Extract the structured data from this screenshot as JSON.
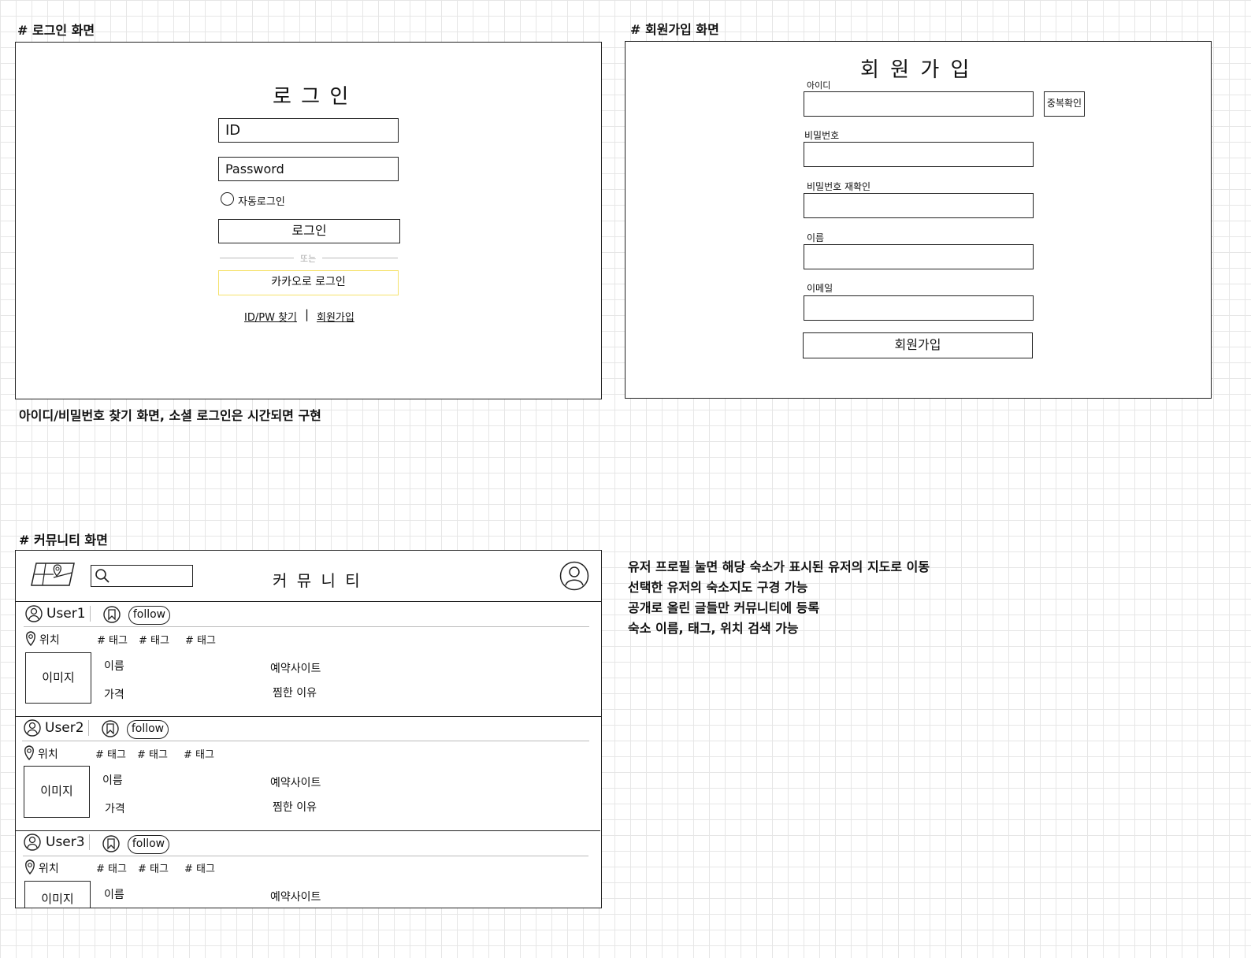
{
  "login": {
    "heading": "# 로그인 화면",
    "title": "로 그 인",
    "id_placeholder": "ID",
    "password_placeholder": "Password",
    "auto_login": "자동로그인",
    "login_button": "로그인",
    "divider": "또는",
    "kakao_button": "카카오로 로그인",
    "find_link": "ID/PW 찾기",
    "link_separator": "|",
    "signup_link": "회원가입",
    "kakao_color": "#f5e26b"
  },
  "signup": {
    "heading": "# 회원가입 화면",
    "title": "회 원 가 입",
    "id_label": "아이디",
    "dup_check": "중복확인",
    "pw_label": "비밀번호",
    "pw_confirm_label": "비밀번호  재확인",
    "name_label": "이름",
    "email_label": "이메일",
    "submit": "회원가입"
  },
  "memo_login": "아이디/비밀번호 찾기 화면, 소셜 로그인은 시간되면 구현",
  "community": {
    "heading": "# 커뮤니티 화면",
    "title": "커 뮤 니 티",
    "posts": [
      {
        "user": "User1",
        "follow": "follow",
        "location": "위치",
        "tags": [
          "# 태그",
          "# 태그",
          "# 태그"
        ],
        "image": "이미지",
        "name": "이름",
        "price": "가격",
        "site": "예약사이트",
        "reason": "찜한 이유"
      },
      {
        "user": "User2",
        "follow": "follow",
        "location": "위치",
        "tags": [
          "# 태그",
          "# 태그",
          "# 태그"
        ],
        "image": "이미지",
        "name": "이름",
        "price": "가격",
        "site": "예약사이트",
        "reason": "찜한 이유"
      },
      {
        "user": "User3",
        "follow": "follow",
        "location": "위치",
        "tags": [
          "# 태그",
          "# 태그",
          "# 태그"
        ],
        "image": "이미지",
        "name": "이름",
        "site": "예약사이트"
      }
    ]
  },
  "notes": [
    "유저 프로필 눌면 해당 숙소가 표시된 유저의 지도로 이동",
    "선택한 유저의 숙소지도 구경 가능",
    "공개로 올린 글들만 커뮤니티에 등록",
    "숙소 이름, 태그, 위치 검색 가능"
  ]
}
